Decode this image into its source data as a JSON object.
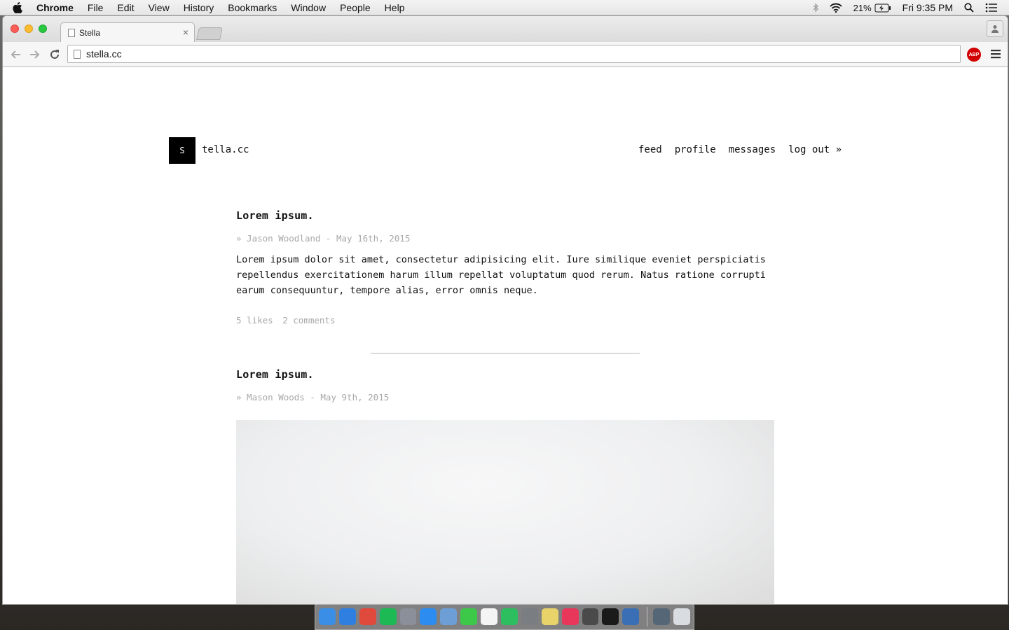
{
  "menubar": {
    "app_name": "Chrome",
    "items": [
      "File",
      "Edit",
      "View",
      "History",
      "Bookmarks",
      "Window",
      "People",
      "Help"
    ],
    "battery": "21%",
    "clock": "Fri 9:35 PM"
  },
  "browser": {
    "tab_title": "Stella",
    "tab_close": "×",
    "url": "stella.cc",
    "abp_label": "ABP"
  },
  "site": {
    "logo_letter": "S",
    "name": "tella.cc",
    "nav": [
      "feed",
      "profile",
      "messages",
      "log out »"
    ]
  },
  "posts": [
    {
      "title": "Lorem ipsum.",
      "meta": "» Jason Woodland - May 16th, 2015",
      "body": "Lorem ipsum dolor sit amet, consectetur adipisicing elit. Iure similique eveniet perspiciatis repellendus exercitationem harum illum repellat voluptatum quod rerum. Natus ratione corrupti earum consequuntur, tempore alias, error omnis neque.",
      "likes": "5 likes",
      "comments": "2 comments"
    },
    {
      "title": "Lorem ipsum.",
      "meta": "» Mason Woods - May 9th, 2015"
    }
  ],
  "dock": {
    "icons": [
      {
        "name": "finder-icon",
        "color": "#3a8ee6"
      },
      {
        "name": "safari-icon",
        "color": "#2f7fe0"
      },
      {
        "name": "chrome-icon",
        "color": "#e04a3c"
      },
      {
        "name": "spotify-icon",
        "color": "#1db954"
      },
      {
        "name": "launchpad-icon",
        "color": "#8a8f99"
      },
      {
        "name": "app-store-icon",
        "color": "#2d8cf0"
      },
      {
        "name": "preview-icon",
        "color": "#6d9fd6"
      },
      {
        "name": "messages-icon",
        "color": "#3ec84a"
      },
      {
        "name": "calendar-icon",
        "color": "#f4f4f4"
      },
      {
        "name": "evernote-icon",
        "color": "#2dbe60"
      },
      {
        "name": "system-preferences-icon",
        "color": "#7a7d82"
      },
      {
        "name": "photos-icon",
        "color": "#e8d36a"
      },
      {
        "name": "itunes-icon",
        "color": "#e8375a"
      },
      {
        "name": "sublime-text-icon",
        "color": "#4a4a4a"
      },
      {
        "name": "terminal-icon",
        "color": "#1a1a1a"
      },
      {
        "name": "quicktime-icon",
        "color": "#3b6fb5"
      }
    ],
    "right_icons": [
      {
        "name": "downloads-stack-icon",
        "color": "#556677"
      },
      {
        "name": "trash-icon",
        "color": "#d9dde2"
      }
    ]
  }
}
